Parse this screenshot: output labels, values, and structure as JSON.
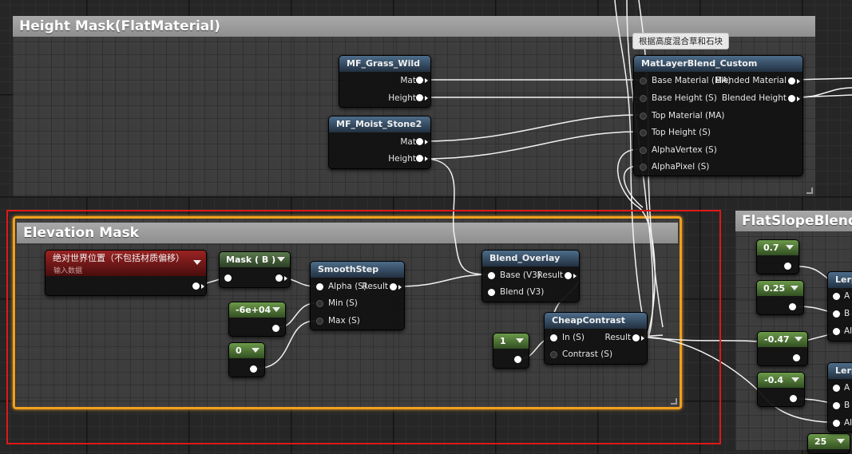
{
  "comments": {
    "height_mask": "Height Mask(FlatMaterial)",
    "elevation_mask": "Elevation Mask",
    "flat_slope": "FlatSlopeBlendM"
  },
  "tooltip": "根据高度混合草和石块",
  "nodes": {
    "grass": {
      "title": "MF_Grass_Wild",
      "out1": "Mat",
      "out2": "Height"
    },
    "stone": {
      "title": "MF_Moist_Stone2",
      "out1": "Mat",
      "out2": "Height"
    },
    "matlayer": {
      "title": "MatLayerBlend_Custom",
      "in1": "Base Material (MA)",
      "in2": "Base Height (S)",
      "in3": "Top Material (MA)",
      "in4": "Top Height (S)",
      "in5": "AlphaVertex (S)",
      "in6": "AlphaPixel (S)",
      "out1": "Blended Material",
      "out2": "Blended Height"
    },
    "worldpos": {
      "title": "绝对世界位置（不包括材质偏移）",
      "subtitle": "输入数据"
    },
    "mask": {
      "title": "Mask ( B )"
    },
    "smoothstep": {
      "title": "SmoothStep",
      "in1": "Alpha (S)",
      "in2": "Min (S)",
      "in3": "Max (S)",
      "out1": "Result"
    },
    "blend_overlay": {
      "title": "Blend_Overlay",
      "in1": "Base (V3)",
      "in2": "Blend (V3)",
      "out1": "Result"
    },
    "cheap_contrast": {
      "title": "CheapContrast",
      "in1": "In (S)",
      "in2": "Contrast (S)",
      "out1": "Result"
    },
    "lerp1": {
      "title": "Lerp",
      "a": "A",
      "b": "B",
      "alpha": "Al"
    },
    "lerp2": {
      "title": "Lerp",
      "a": "A",
      "b": "B",
      "alpha": "Al"
    }
  },
  "constants": {
    "neg6e4": "-6e+04",
    "zero": "0",
    "one": "1",
    "c07": "0.7",
    "c025": "0.25",
    "cneg047": "-0.47",
    "cneg04": "-0.4",
    "c25": "25"
  },
  "colors": {
    "selection": "#e01818",
    "highlight": "#f0a020",
    "node_header": "#4d6c8a",
    "const_header": "#6b9a4a"
  }
}
